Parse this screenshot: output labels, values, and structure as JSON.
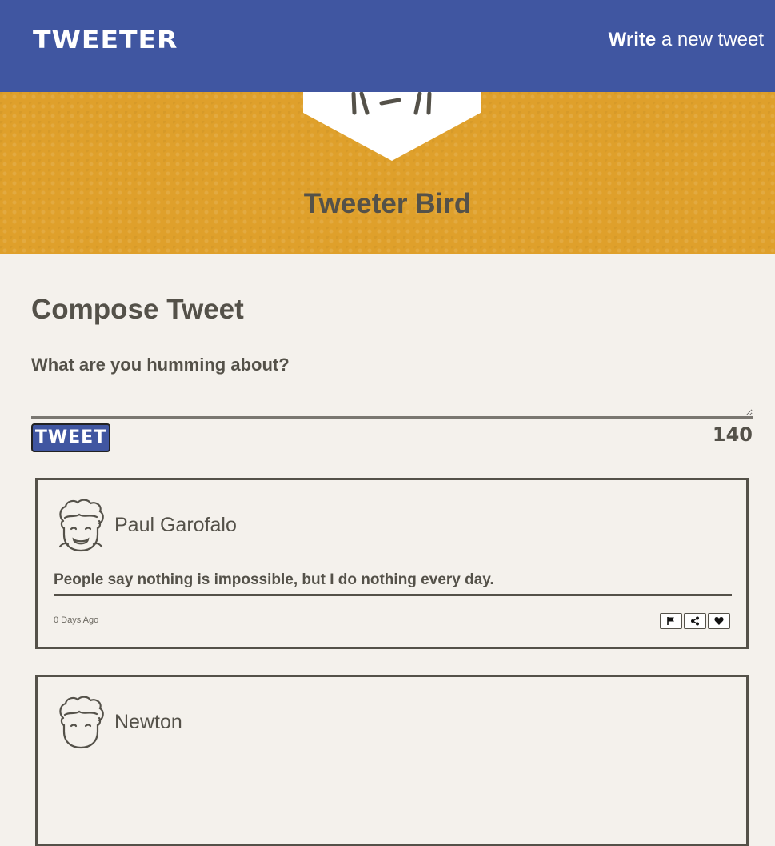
{
  "nav": {
    "brand": "TWEETER",
    "write_bold": "Write",
    "write_rest": " a new tweet"
  },
  "profile": {
    "name": "Tweeter Bird"
  },
  "compose": {
    "title": "Compose Tweet",
    "label": "What are you humming about?",
    "textarea_value": "",
    "button_label": "TWEET",
    "counter": "140"
  },
  "tweets": [
    {
      "author": "Paul Garofalo",
      "content": "People say nothing is impossible, but I do nothing every day.",
      "age": "0 Days Ago"
    },
    {
      "author": "Newton",
      "content": "",
      "age": ""
    }
  ],
  "colors": {
    "nav": "#4056a1",
    "banner": "#dfa02b",
    "page": "#f4f1ec",
    "text": "#545149"
  },
  "icons": {
    "flag": "flag-icon",
    "retweet": "share-icon",
    "like": "heart-icon"
  }
}
